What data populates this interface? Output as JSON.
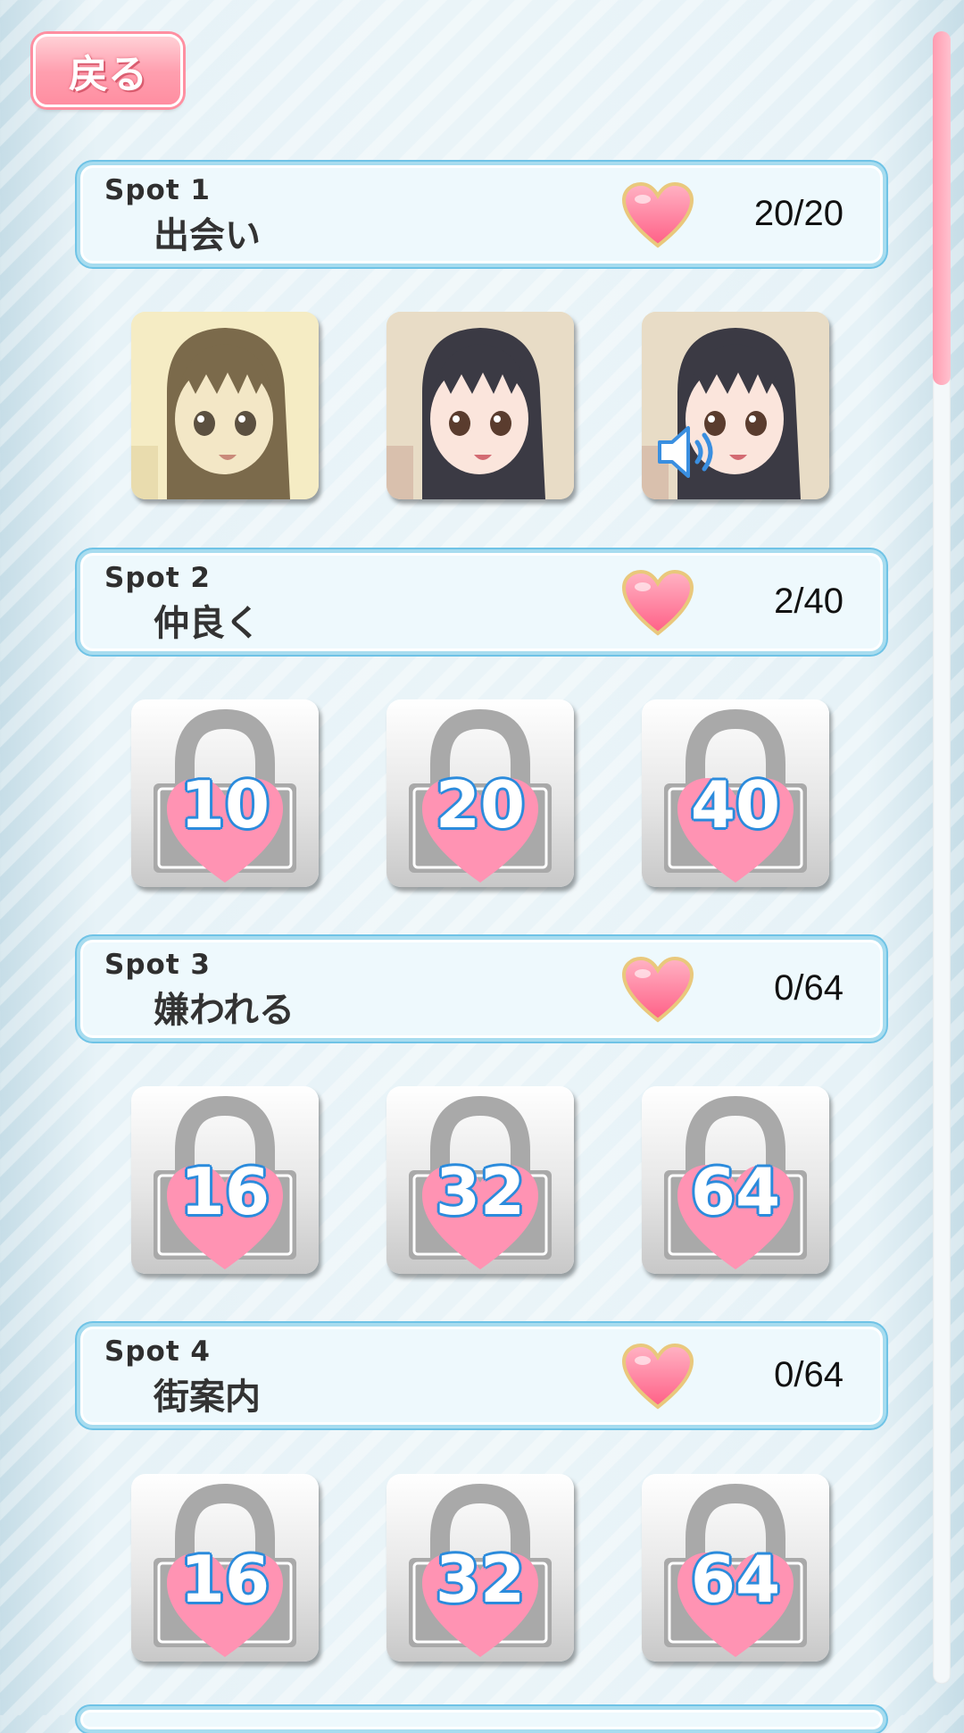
{
  "back_button": {
    "label": "戻る"
  },
  "spots": [
    {
      "num": "Spot 1",
      "title": "出会い",
      "count": "20/20",
      "tiles": [
        {
          "kind": "portrait",
          "tone": "sepia"
        },
        {
          "kind": "portrait",
          "tone": "color"
        },
        {
          "kind": "portrait",
          "tone": "color",
          "icon": "speaker-icon"
        }
      ]
    },
    {
      "num": "Spot 2",
      "title": "仲良く",
      "count": "2/40",
      "tiles": [
        {
          "kind": "locked",
          "value": "10"
        },
        {
          "kind": "locked",
          "value": "20"
        },
        {
          "kind": "locked",
          "value": "40"
        }
      ]
    },
    {
      "num": "Spot 3",
      "title": "嫌われる",
      "count": "0/64",
      "tiles": [
        {
          "kind": "locked",
          "value": "16"
        },
        {
          "kind": "locked",
          "value": "32"
        },
        {
          "kind": "locked",
          "value": "64"
        }
      ]
    },
    {
      "num": "Spot 4",
      "title": "街案内",
      "count": "0/64",
      "tiles": [
        {
          "kind": "locked",
          "value": "16"
        },
        {
          "kind": "locked",
          "value": "32"
        },
        {
          "kind": "locked",
          "value": "64"
        }
      ]
    }
  ],
  "colors": {
    "accent_pink": "#ff8ea1",
    "frame_blue": "#6fc3e6",
    "lock_number_outline": "#2b8bdc",
    "heart": "#ff7f9c"
  },
  "icons": {
    "heart": "heart-icon",
    "lock": "lock-icon",
    "speaker": "speaker-icon"
  }
}
